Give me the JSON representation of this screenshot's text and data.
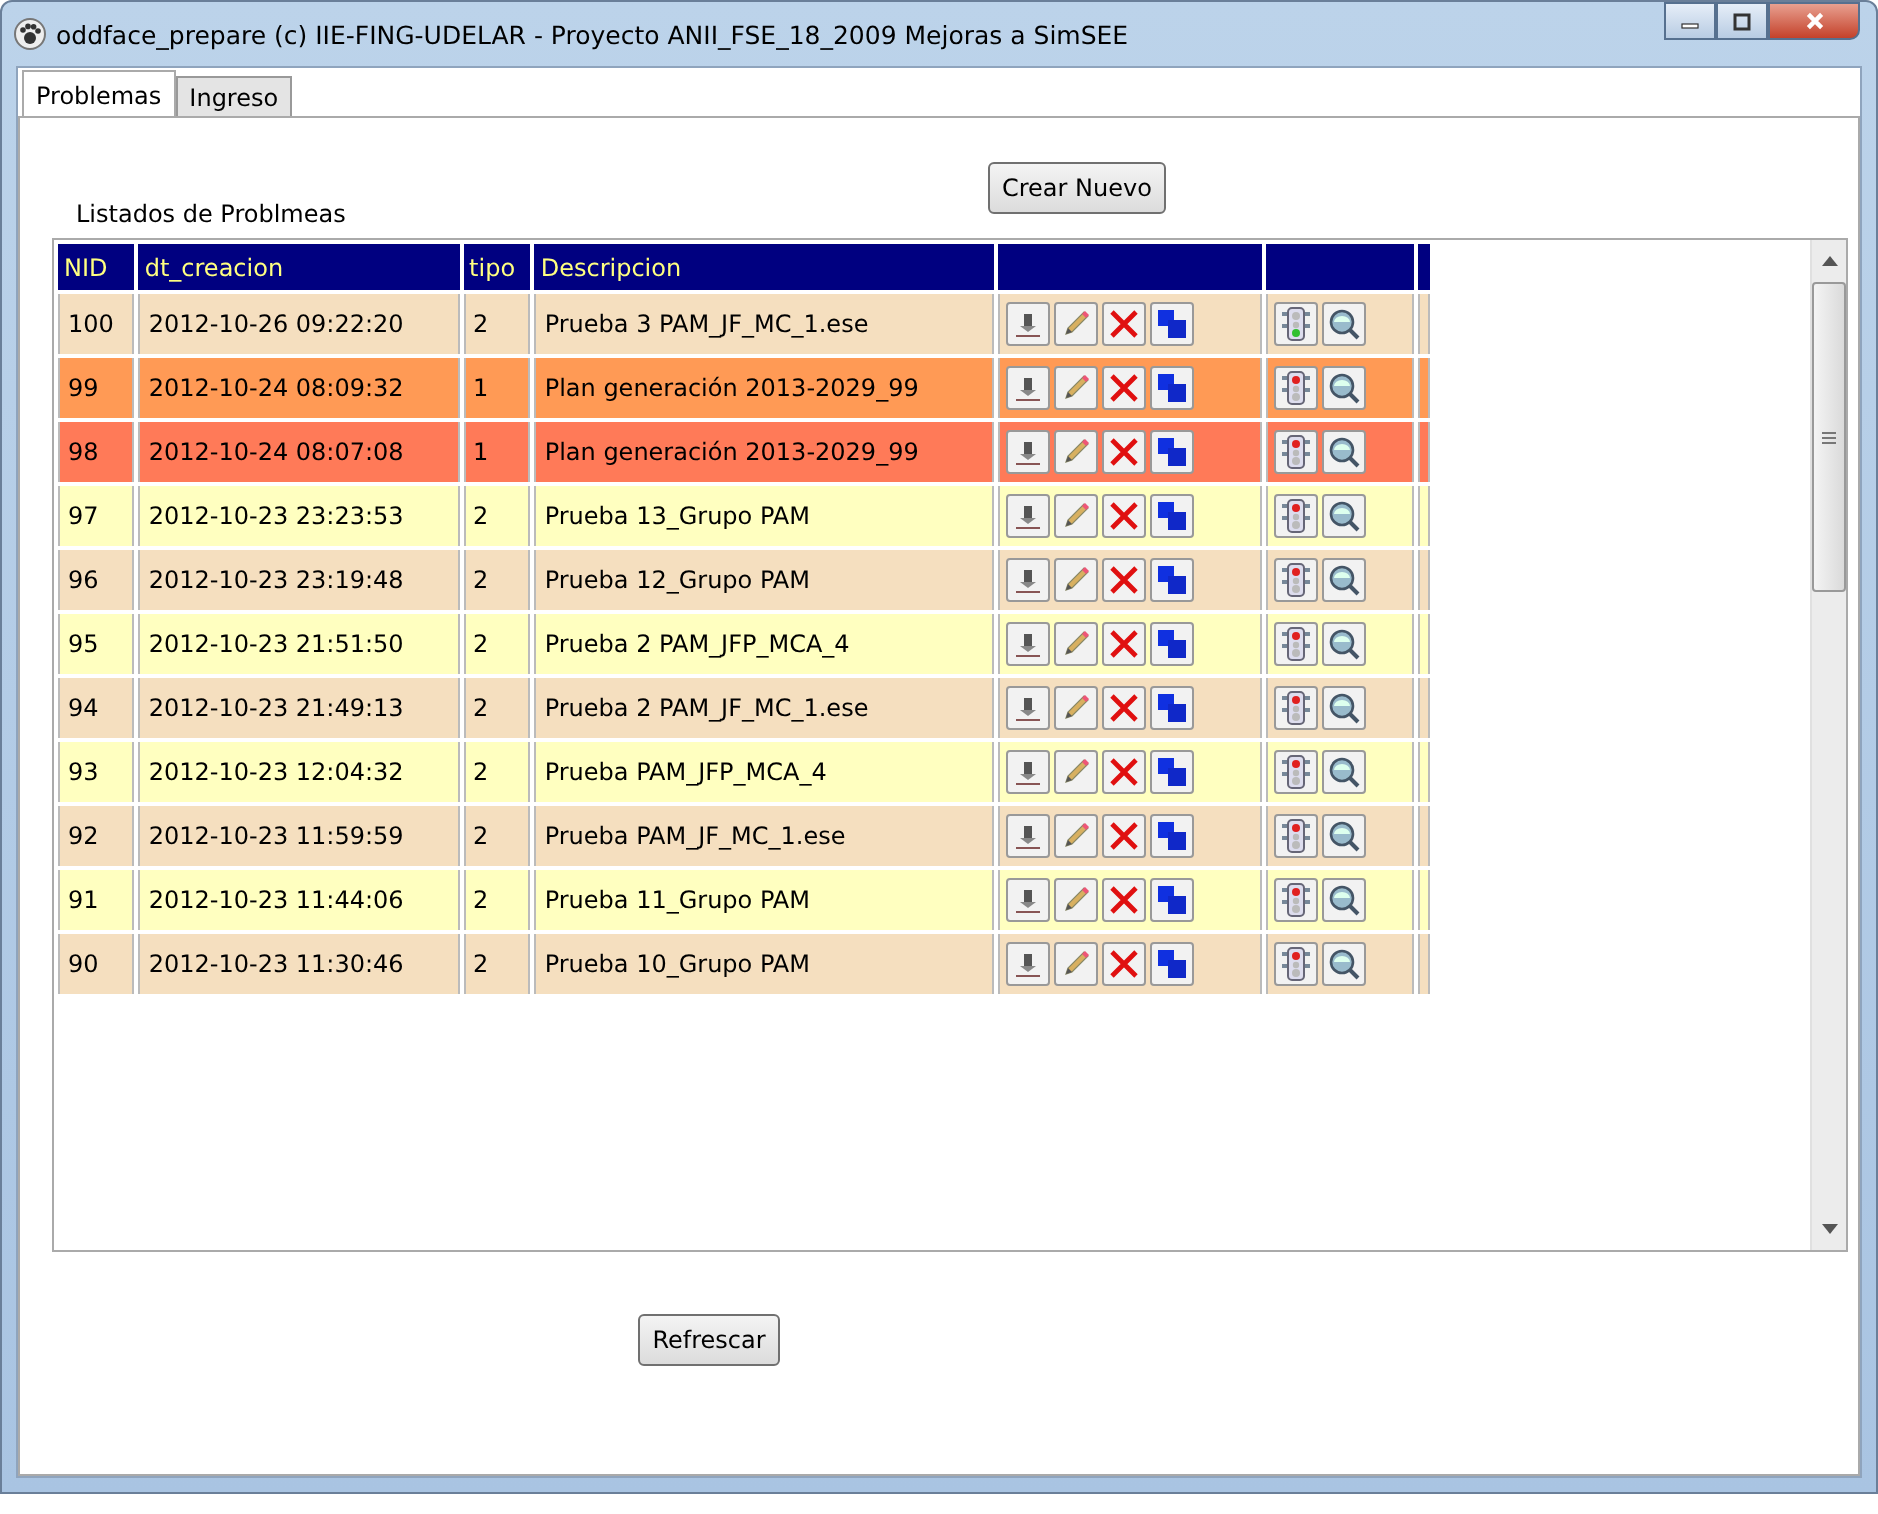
{
  "window": {
    "title": "oddface_prepare (c) IIE-FING-UDELAR - Proyecto ANII_FSE_18_2009 Mejoras a SimSEE"
  },
  "tabs": [
    {
      "label": "Problemas",
      "selected": true
    },
    {
      "label": "Ingreso",
      "selected": false
    }
  ],
  "list_title": "Listados de Problmeas",
  "create_button": "Crear Nuevo",
  "table": {
    "columns": [
      "NID",
      "dt_creacion",
      "tipo",
      "Descripcion"
    ],
    "rows": [
      {
        "nid": "100",
        "dt_creacion": "2012-10-26 09:22:20",
        "tipo": "2",
        "descripcion": "Prueba 3 PAM_JF_MC_1.ese",
        "color": "#f5dfbf",
        "ready": true
      },
      {
        "nid": "99",
        "dt_creacion": "2012-10-24 08:09:32",
        "tipo": "1",
        "descripcion": "Plan generación 2013-2029_99",
        "color": "#ff9a55",
        "ready": false
      },
      {
        "nid": "98",
        "dt_creacion": "2012-10-24 08:07:08",
        "tipo": "1",
        "descripcion": "Plan generación 2013-2029_99",
        "color": "#ff7a58",
        "ready": false
      },
      {
        "nid": "97",
        "dt_creacion": "2012-10-23 23:23:53",
        "tipo": "2",
        "descripcion": "Prueba 13_Grupo PAM",
        "color": "#ffffc0",
        "ready": false
      },
      {
        "nid": "96",
        "dt_creacion": "2012-10-23 23:19:48",
        "tipo": "2",
        "descripcion": "Prueba 12_Grupo PAM",
        "color": "#f5dfbf",
        "ready": false
      },
      {
        "nid": "95",
        "dt_creacion": "2012-10-23 21:51:50",
        "tipo": "2",
        "descripcion": "Prueba 2 PAM_JFP_MCA_4",
        "color": "#ffffc0",
        "ready": false
      },
      {
        "nid": "94",
        "dt_creacion": "2012-10-23 21:49:13",
        "tipo": "2",
        "descripcion": "Prueba 2 PAM_JF_MC_1.ese",
        "color": "#f5dfbf",
        "ready": false
      },
      {
        "nid": "93",
        "dt_creacion": "2012-10-23 12:04:32",
        "tipo": "2",
        "descripcion": "Prueba PAM_JFP_MCA_4",
        "color": "#ffffc0",
        "ready": false
      },
      {
        "nid": "92",
        "dt_creacion": "2012-10-23 11:59:59",
        "tipo": "2",
        "descripcion": "Prueba PAM_JF_MC_1.ese",
        "color": "#f5dfbf",
        "ready": false
      },
      {
        "nid": "91",
        "dt_creacion": "2012-10-23 11:44:06",
        "tipo": "2",
        "descripcion": "Prueba 11_Grupo PAM",
        "color": "#ffffc0",
        "ready": false
      },
      {
        "nid": "90",
        "dt_creacion": "2012-10-23 11:30:46",
        "tipo": "2",
        "descripcion": "Prueba 10_Grupo PAM",
        "color": "#f5dfbf",
        "ready": false
      }
    ]
  },
  "refresh_button": "Refrescar"
}
